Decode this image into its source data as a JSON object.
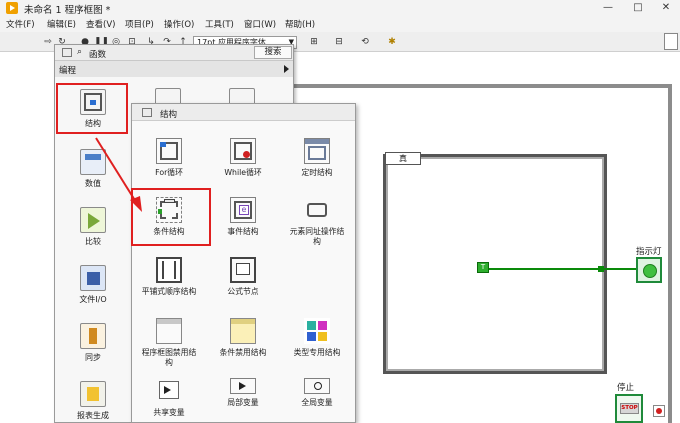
{
  "window": {
    "title": "未命名 1 程序框图 *",
    "controls": [
      "—",
      "□",
      "✕"
    ]
  },
  "menu": [
    "文件(F)",
    "编辑(E)",
    "查看(V)",
    "项目(P)",
    "操作(O)",
    "工具(T)",
    "窗口(W)",
    "帮助(H)"
  ],
  "toolbar": {
    "font": "17pt 应用程序字体",
    "font_arrow": "▼"
  },
  "functions_palette": {
    "title": "函数",
    "search_label": "搜索",
    "category": "编程",
    "items": [
      {
        "label": "结构",
        "icon": "structures-icon"
      },
      {
        "label": "数值",
        "icon": "numeric-icon"
      },
      {
        "label": "比较",
        "icon": "comparison-icon"
      },
      {
        "label": "文件I/O",
        "icon": "file-io-icon"
      },
      {
        "label": "同步",
        "icon": "synchronization-icon"
      },
      {
        "label": "报表生成",
        "icon": "report-generation-icon"
      }
    ]
  },
  "structures_palette": {
    "title": "结构",
    "items": [
      {
        "label": "For循环",
        "icon": "for-loop-icon"
      },
      {
        "label": "While循环",
        "icon": "while-loop-icon"
      },
      {
        "label": "定时结构",
        "icon": "timed-structure-icon"
      },
      {
        "label": "条件结构",
        "icon": "case-structure-icon"
      },
      {
        "label": "事件结构",
        "icon": "event-structure-icon"
      },
      {
        "label": "元素同址操作结",
        "label2": "构",
        "icon": "in-place-element-icon"
      },
      {
        "label": "平铺式顺序结构",
        "icon": "flat-sequence-icon"
      },
      {
        "label": "公式节点",
        "icon": "formula-node-icon"
      },
      {
        "label": "",
        "icon": "blank-icon"
      },
      {
        "label": "程序框图禁用结",
        "label2": "构",
        "icon": "diagram-disable-icon"
      },
      {
        "label": "条件禁用结构",
        "icon": "conditional-disable-icon"
      },
      {
        "label": "类型专用结构",
        "icon": "type-specialization-icon"
      },
      {
        "label": "共享变量",
        "icon": "shared-variable-icon"
      },
      {
        "label": "局部变量",
        "icon": "local-variable-icon"
      },
      {
        "label": "全局变量",
        "icon": "global-variable-icon"
      }
    ]
  },
  "diagram": {
    "case_selector": "真",
    "case_selector_arrows": "◀ ▼ ▶",
    "bool_constant": "T",
    "indicator_label": "指示灯",
    "stop_label": "停止",
    "stop_text": "STOP"
  }
}
